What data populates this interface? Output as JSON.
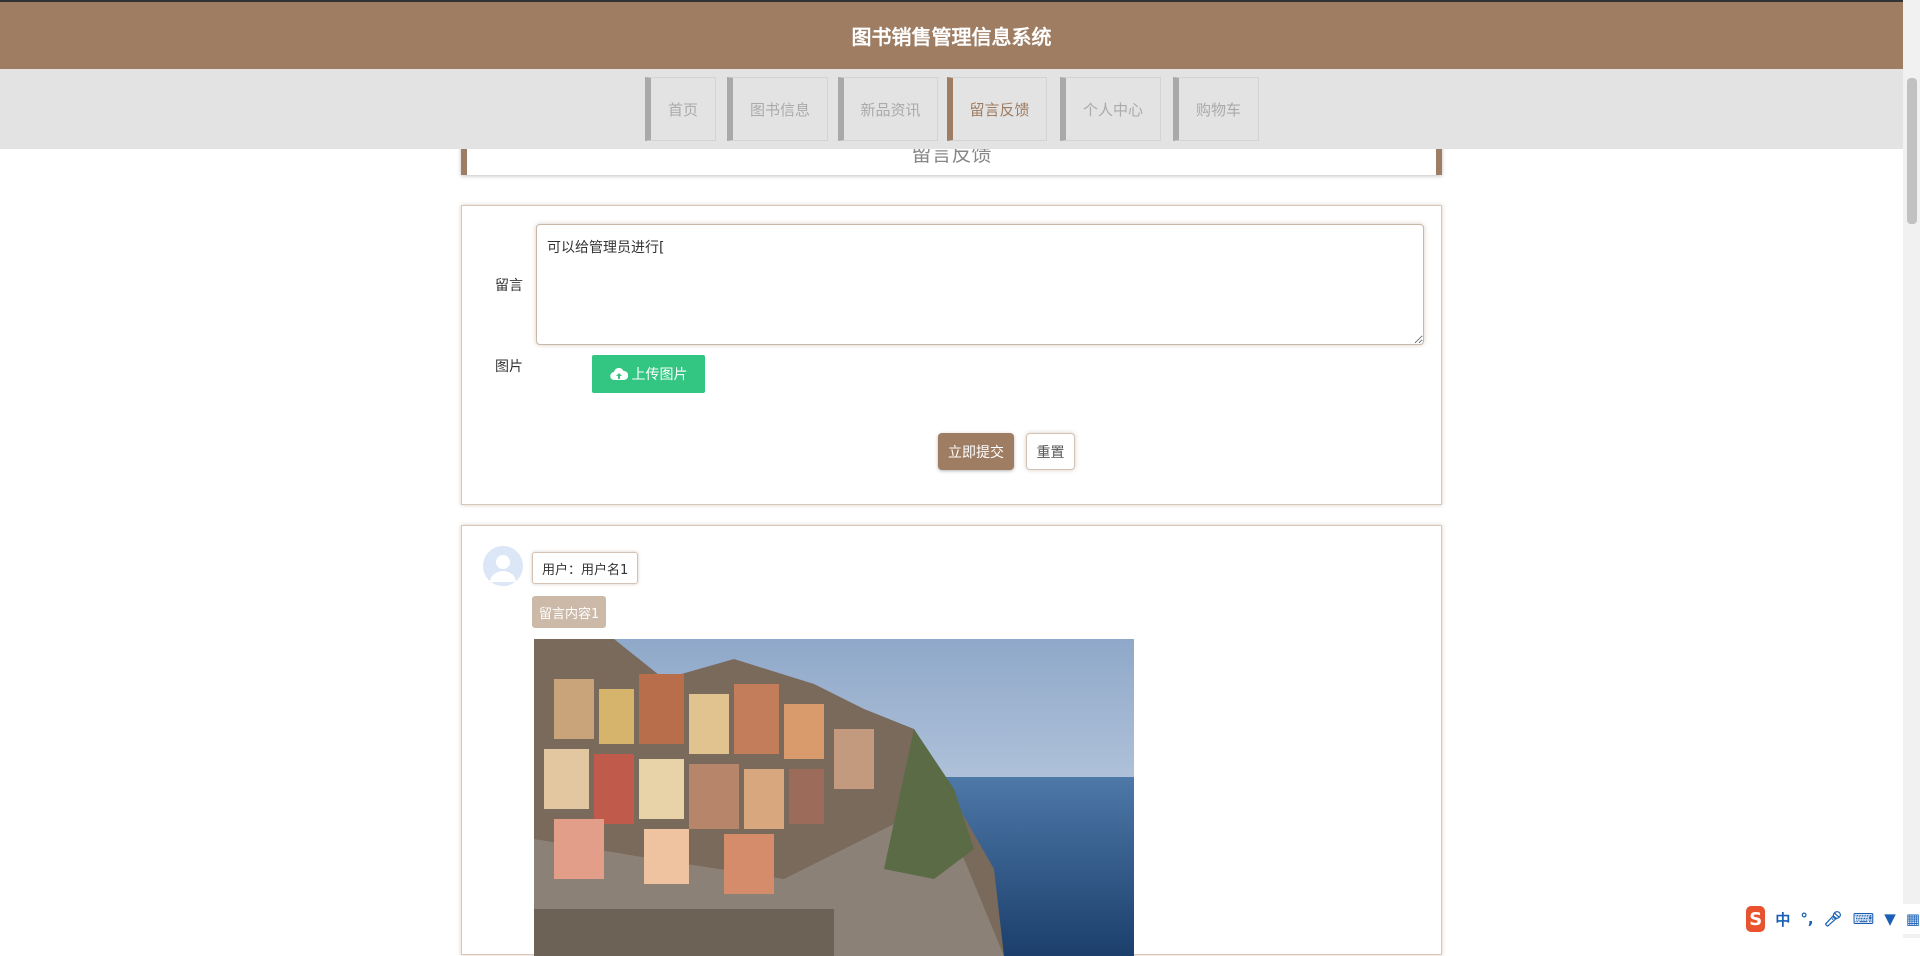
{
  "header": {
    "title": "图书销售管理信息系统"
  },
  "nav": {
    "items": [
      {
        "label": "首页"
      },
      {
        "label": "图书信息"
      },
      {
        "label": "新品资讯"
      },
      {
        "label": "留言反馈"
      },
      {
        "label": "个人中心"
      },
      {
        "label": "购物车"
      }
    ],
    "active": "留言反馈"
  },
  "page": {
    "title": "留言反馈"
  },
  "form": {
    "message_label": "留言",
    "message_value": "可以给管理员进行[",
    "image_label": "图片",
    "upload_label": "上传图片",
    "submit_label": "立即提交",
    "reset_label": "重置"
  },
  "messages": [
    {
      "user": "用户：用户名1",
      "content": "留言内容1"
    }
  ],
  "ime": {
    "mode": "中",
    "punct": "°,",
    "logo": "S"
  },
  "colors": {
    "brand": "#9e7d63",
    "upload": "#32c682",
    "nav_bg": "#e3e3e3",
    "tag": "#cdb9a8"
  }
}
